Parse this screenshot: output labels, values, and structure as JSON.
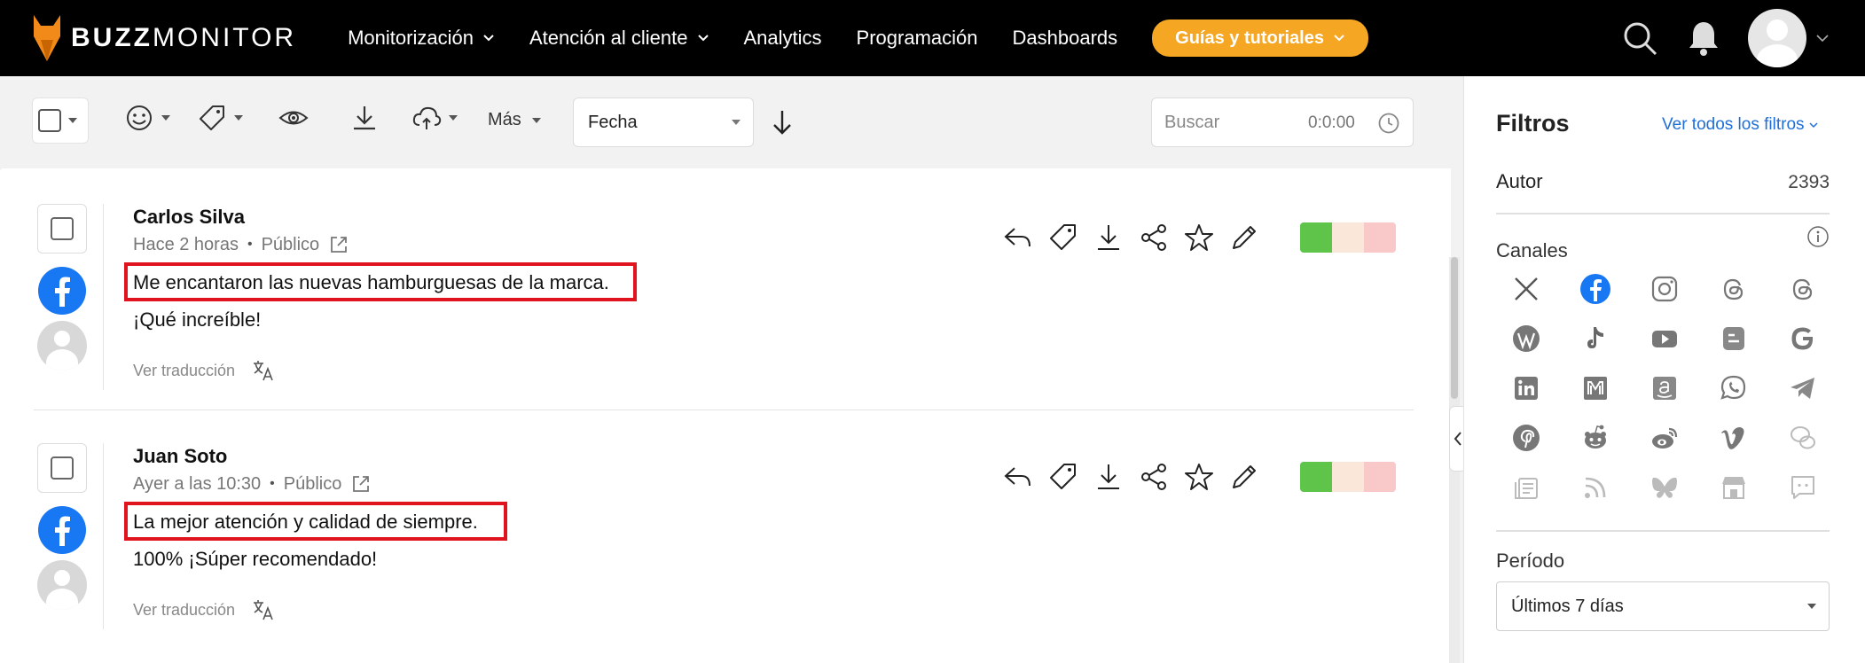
{
  "app": {
    "logo_bold": "BUZZ",
    "logo_light": "MONITOR"
  },
  "nav": {
    "items": [
      {
        "label": "Monitorización",
        "dropdown": true
      },
      {
        "label": "Atención al cliente",
        "dropdown": true
      },
      {
        "label": "Analytics",
        "dropdown": false
      },
      {
        "label": "Programación",
        "dropdown": false
      },
      {
        "label": "Dashboards",
        "dropdown": false
      }
    ],
    "guide_label": "Guías y tutoriales",
    "guide_color": "#f5a623"
  },
  "toolbar": {
    "more_label": "Más",
    "sort_select_value": "Fecha",
    "search_placeholder": "Buscar",
    "search_time": "0:0:00"
  },
  "posts": [
    {
      "author": "Carlos Silva",
      "time": "Hace 2 horas",
      "visibility": "Público",
      "text_highlighted": "Me encantaron las nuevas hamburguesas de la marca.",
      "text_rest": "¡Qué increíble!",
      "translate_label": "Ver traducción",
      "channel": "facebook"
    },
    {
      "author": "Juan Soto",
      "time": "Ayer a las 10:30",
      "visibility": "Público",
      "text_highlighted": "La mejor atención y calidad de siempre.",
      "text_rest": "100% ¡Súper recomendado!",
      "translate_label": "Ver traducción",
      "channel": "facebook"
    }
  ],
  "sentiment_colors": {
    "positive": "#5fc44a",
    "neutral": "#fbe7d9",
    "negative": "#f9c8c8"
  },
  "highlight_color": "#e0141e",
  "filters": {
    "title": "Filtros",
    "view_all_label": "Ver todos los filtros",
    "author_label": "Autor",
    "author_count": "2393",
    "channels_label": "Canales",
    "channels": [
      "x-icon",
      "facebook-icon",
      "instagram-icon",
      "threads-icon",
      "threads-alt-icon",
      "wordpress-icon",
      "tiktok-icon",
      "youtube-icon",
      "blogger-icon",
      "google-icon",
      "linkedin-icon",
      "medium-icon",
      "amazon-icon",
      "whatsapp-icon",
      "telegram-icon",
      "pinterest-icon",
      "reddit-icon",
      "weibo-icon",
      "vimeo-icon",
      "wechat-icon",
      "news-icon",
      "rss-icon",
      "bluesky-icon",
      "store-icon",
      "chat-icon"
    ],
    "period_label": "Período",
    "period_value": "Últimos 7 días"
  }
}
